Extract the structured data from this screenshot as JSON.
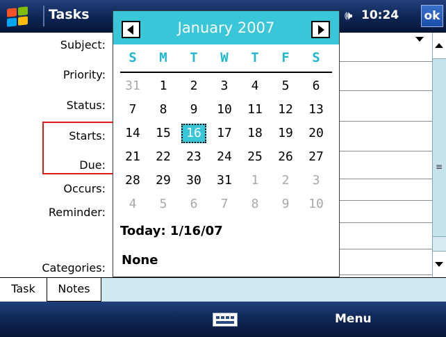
{
  "titlebar": {
    "app_title": "Tasks",
    "clock": "10:24",
    "ok_label": "ok"
  },
  "form": {
    "labels": {
      "subject": "Subject:",
      "priority": "Priority:",
      "status": "Status:",
      "starts": "Starts:",
      "due": "Due:",
      "occurs": "Occurs:",
      "reminder": "Reminder:",
      "categories": "Categories:"
    }
  },
  "calendar": {
    "month_title": "January 2007",
    "weekdays": [
      "S",
      "M",
      "T",
      "W",
      "T",
      "F",
      "S"
    ],
    "weeks": [
      [
        "31",
        "1",
        "2",
        "3",
        "4",
        "5",
        "6"
      ],
      [
        "7",
        "8",
        "9",
        "10",
        "11",
        "12",
        "13"
      ],
      [
        "14",
        "15",
        "16",
        "17",
        "18",
        "19",
        "20"
      ],
      [
        "21",
        "22",
        "23",
        "24",
        "25",
        "26",
        "27"
      ],
      [
        "28",
        "29",
        "30",
        "31",
        "1",
        "2",
        "3"
      ],
      [
        "4",
        "5",
        "6",
        "7",
        "8",
        "9",
        "10"
      ]
    ],
    "selected_day": "16",
    "today_text": "Today: 1/16/07",
    "none_text": "None"
  },
  "tabs": [
    "Task",
    "Notes"
  ],
  "softkeys": {
    "right_label": "Menu"
  },
  "colors": {
    "accent": "#38c6d8",
    "titlebar": "#0d2452",
    "highlight_box": "#e01818"
  },
  "icons": {
    "start": "windows-flag-icon",
    "volume": "speaker-icon",
    "keyboard": "keyboard-icon"
  }
}
